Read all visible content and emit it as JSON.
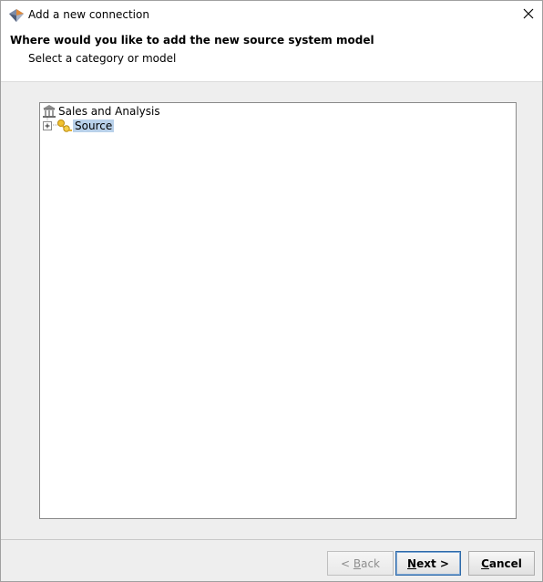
{
  "window": {
    "title": "Add a new connection",
    "close_glyph": "✕"
  },
  "header": {
    "title": "Where would you like to add the new source system model",
    "subtitle": "Select a category or model"
  },
  "tree": {
    "root": {
      "label": "Sales and Analysis",
      "icon": "library-icon"
    },
    "child": {
      "label": "Source",
      "icon": "keys-icon",
      "expand_glyph": "+",
      "selected": true
    }
  },
  "buttons": {
    "back": {
      "prefix": "< ",
      "mnemonic": "B",
      "rest": "ack",
      "enabled": false
    },
    "next": {
      "mnemonic": "N",
      "rest": "ext >",
      "enabled": true,
      "default": true
    },
    "cancel": {
      "mnemonic": "C",
      "rest": "ancel",
      "enabled": true
    }
  },
  "colors": {
    "selection": "#b9d1ea",
    "panel_bg": "#eeeeee",
    "default_button_border": "#2e6aa9"
  }
}
